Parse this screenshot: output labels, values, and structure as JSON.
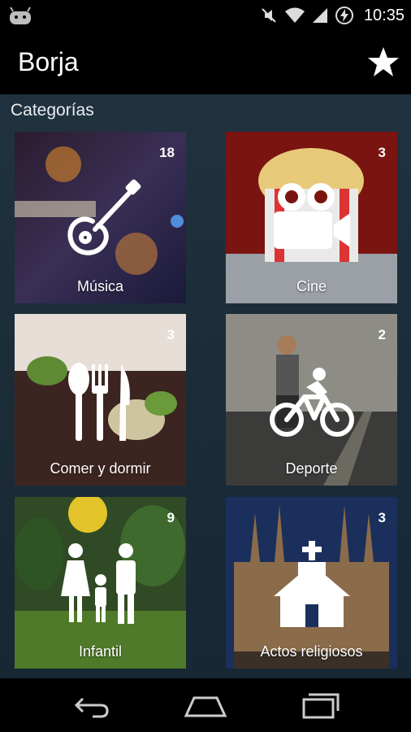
{
  "status_bar": {
    "time": "10:35"
  },
  "app_bar": {
    "title": "Borja"
  },
  "section": {
    "title": "Categorías"
  },
  "categories": [
    {
      "label": "Música",
      "count": "18",
      "icon": "guitar-icon"
    },
    {
      "label": "Cine",
      "count": "3",
      "icon": "movie-camera-icon"
    },
    {
      "label": "Comer y dormir",
      "count": "3",
      "icon": "cutlery-icon"
    },
    {
      "label": "Deporte",
      "count": "2",
      "icon": "bicycle-icon"
    },
    {
      "label": "Infantil",
      "count": "9",
      "icon": "family-icon"
    },
    {
      "label": "Actos religiosos",
      "count": "3",
      "icon": "church-icon"
    }
  ],
  "colors": {
    "app_bg": "#000000",
    "content_bg": "#1d2e3a",
    "text": "#ffffff"
  }
}
